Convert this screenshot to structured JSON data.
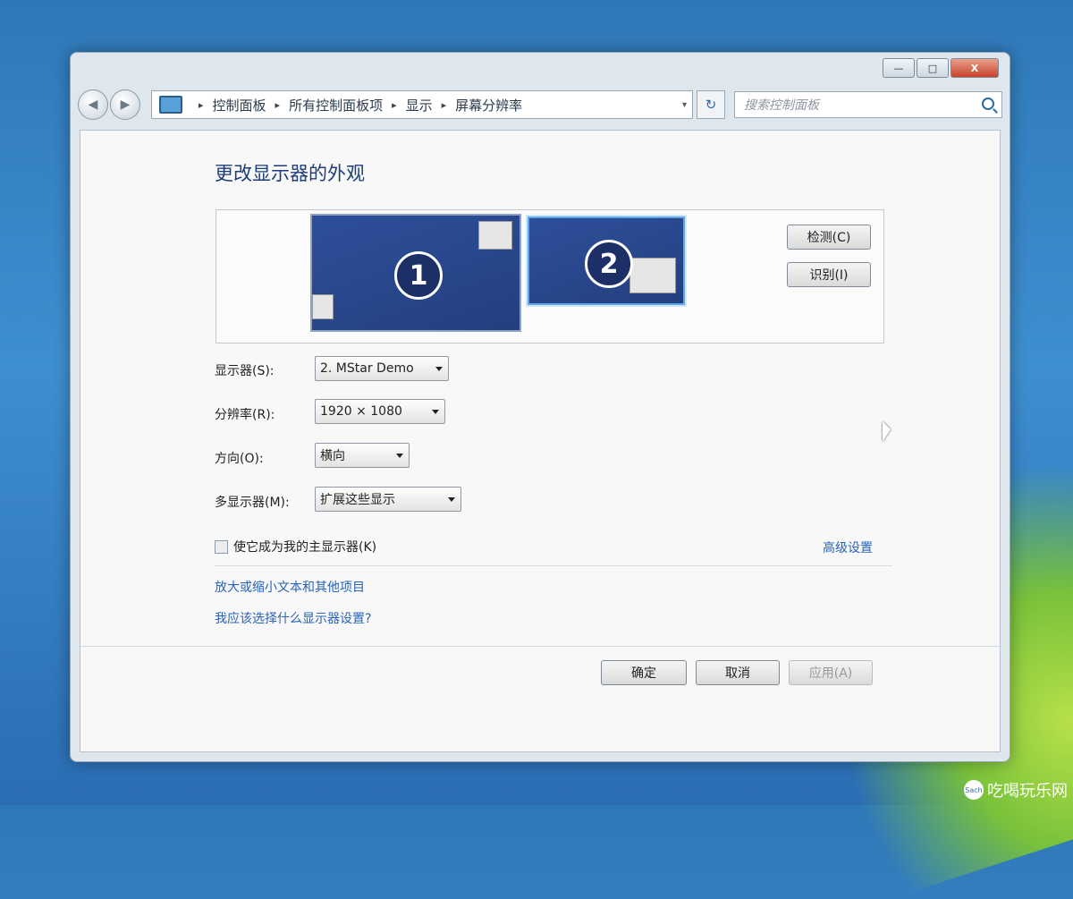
{
  "window": {
    "controls": {
      "minimize": "—",
      "maximize": "□",
      "close": "X"
    }
  },
  "nav": {
    "back": "◀",
    "forward": "▶"
  },
  "address_bar": {
    "crumbs": [
      "控制面板",
      "所有控制面板项",
      "显示",
      "屏幕分辨率"
    ],
    "separator": "▸",
    "dropdown_arrow": "▾",
    "refresh": "↻"
  },
  "search": {
    "placeholder": "搜索控制面板"
  },
  "page": {
    "heading": "更改显示器的外观",
    "monitor_1_label": "1",
    "monitor_2_label": "2",
    "detect_button": "检测(C)",
    "identify_button": "识别(I)",
    "display_label": "显示器(S):",
    "display_value": "2. MStar Demo",
    "resolution_label": "分辨率(R):",
    "resolution_value": "1920 × 1080",
    "orientation_label": "方向(O):",
    "orientation_value": "横向",
    "multi_display_label": "多显示器(M):",
    "multi_display_value": "扩展这些显示",
    "primary_checkbox_label": "使它成为我的主显示器(K)",
    "advanced_link": "高级设置",
    "link_text_size": "放大或缩小文本和其他项目",
    "link_which_settings": "我应该选择什么显示器设置?",
    "ok_button": "确定",
    "cancel_button": "取消",
    "apply_button": "应用(A)"
  },
  "watermark": {
    "logo_text": "Sach",
    "text": "吃喝玩乐网"
  }
}
